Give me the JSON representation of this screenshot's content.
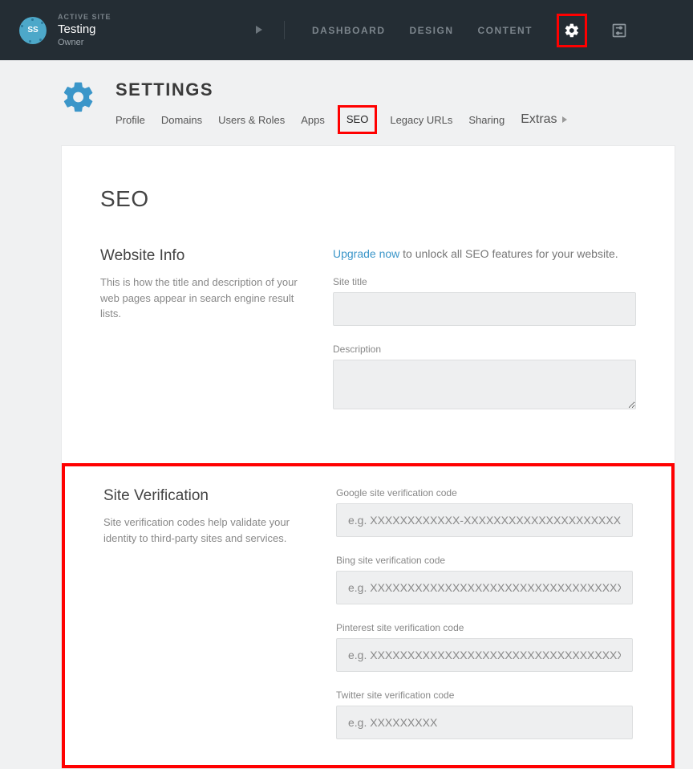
{
  "topbar": {
    "active_site_label": "ACTIVE SITE",
    "site_name": "Testing",
    "site_role": "Owner",
    "avatar_initials": "SS",
    "nav": {
      "dashboard": "DASHBOARD",
      "design": "DESIGN",
      "content": "CONTENT"
    }
  },
  "header": {
    "title": "SETTINGS",
    "tabs": {
      "profile": "Profile",
      "domains": "Domains",
      "users_roles": "Users & Roles",
      "apps": "Apps",
      "seo": "SEO",
      "legacy_urls": "Legacy URLs",
      "sharing": "Sharing",
      "extras": "Extras"
    }
  },
  "panel": {
    "title": "SEO",
    "website_info": {
      "heading": "Website Info",
      "desc": "This is how the title and description of your web pages appear in search engine result lists.",
      "upgrade_link": "Upgrade now",
      "upgrade_rest": " to unlock all SEO features for your website.",
      "site_title_label": "Site title",
      "site_title_value": "",
      "description_label": "Description",
      "description_value": ""
    },
    "site_verification": {
      "heading": "Site Verification",
      "desc": "Site verification codes help validate your identity to third-party sites and services.",
      "fields": {
        "google": {
          "label": "Google site verification code",
          "placeholder": "e.g. XXXXXXXXXXXX-XXXXXXXXXXXXXXXXXXXXX",
          "value": ""
        },
        "bing": {
          "label": "Bing site verification code",
          "placeholder": "e.g. XXXXXXXXXXXXXXXXXXXXXXXXXXXXXXXXXXX",
          "value": ""
        },
        "pinterest": {
          "label": "Pinterest site verification code",
          "placeholder": "e.g. XXXXXXXXXXXXXXXXXXXXXXXXXXXXXXXXXXX",
          "value": ""
        },
        "twitter": {
          "label": "Twitter site verification code",
          "placeholder": "e.g. XXXXXXXXX",
          "value": ""
        }
      }
    }
  }
}
